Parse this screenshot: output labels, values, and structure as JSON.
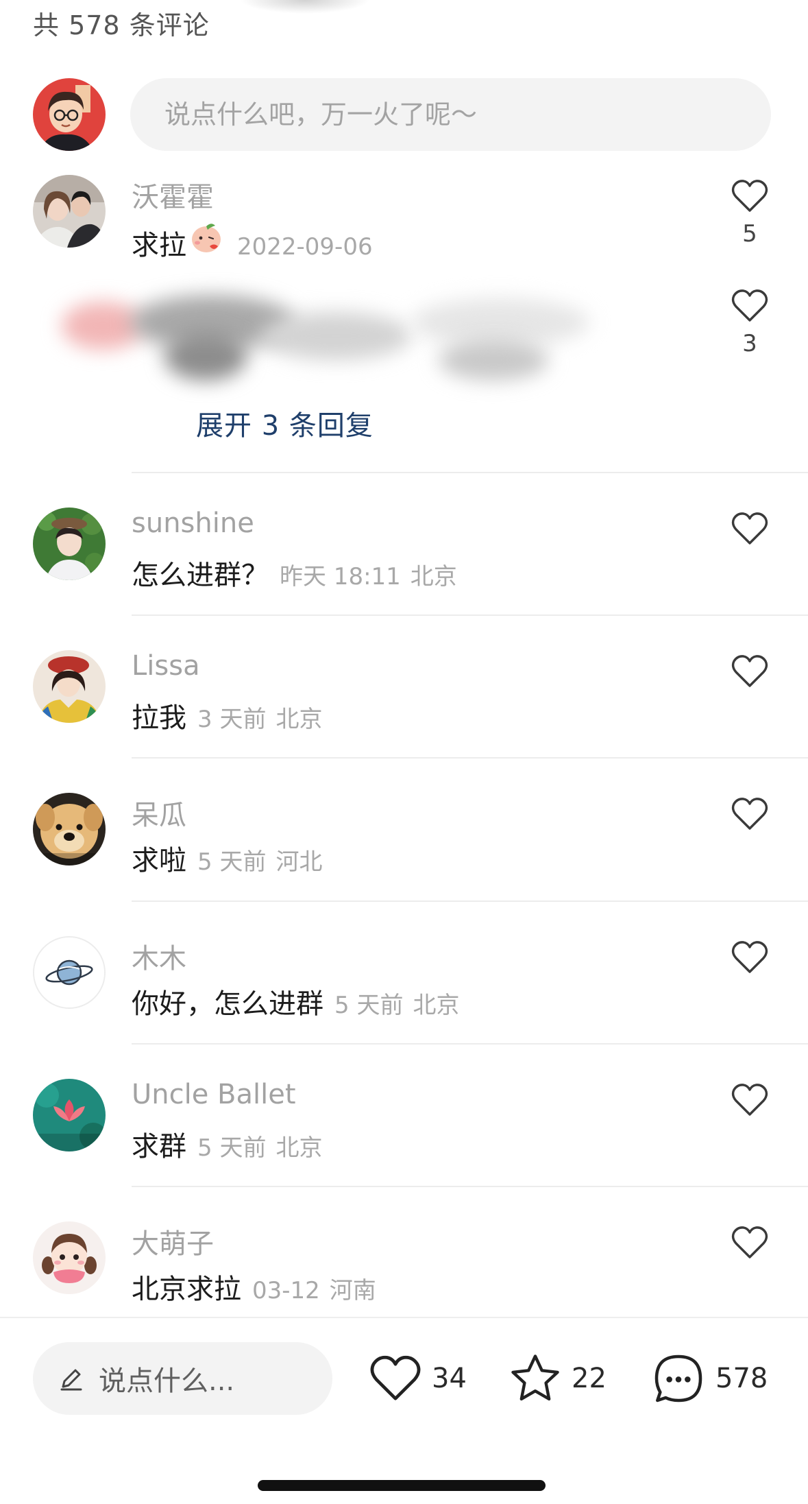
{
  "header": {
    "comment_count_text": "共 578 条评论"
  },
  "composer": {
    "placeholder": "说点什么吧，万一火了呢～"
  },
  "comments": [
    {
      "name": "沃霍霍",
      "text": "求拉",
      "time": "2022-09-06",
      "place": "",
      "likes": "5",
      "avatar_icon": "avatar-couple-photo"
    },
    {
      "name": "sunshine",
      "text": "怎么进群？",
      "time": "昨天 18:11",
      "place": "北京",
      "likes": "",
      "avatar_icon": "avatar-girl-greenery"
    },
    {
      "name": "Lissa",
      "text": "拉我",
      "time": "3 天前",
      "place": "北京",
      "likes": "",
      "avatar_icon": "avatar-girl-red-hat"
    },
    {
      "name": "呆瓜",
      "text": "求啦",
      "time": "5 天前",
      "place": "河北",
      "likes": "",
      "avatar_icon": "avatar-puppy"
    },
    {
      "name": "木木",
      "text": "你好，怎么进群",
      "time": "5 天前",
      "place": "北京",
      "likes": "",
      "avatar_icon": "avatar-planet"
    },
    {
      "name": "Uncle Ballet",
      "text": "求群",
      "time": "5 天前",
      "place": "北京",
      "likes": "",
      "avatar_icon": "avatar-teal-lotus"
    },
    {
      "name": "大萌子",
      "text": "北京求拉",
      "time": "03-12",
      "place": "河南",
      "likes": "",
      "avatar_icon": "avatar-cartoon-girl"
    }
  ],
  "blurred_reply": {
    "likes": "3"
  },
  "expand_replies_label": "展开 3 条回复",
  "bottom_bar": {
    "input_placeholder": "说点什么...",
    "likes_count": "34",
    "favorites_count": "22",
    "comments_count": "578"
  },
  "colors": {
    "expand_link": "#1f3f6b",
    "name_grey": "#a2a2a2",
    "meta_grey": "#a8a8a8",
    "input_bg": "#f3f3f3"
  }
}
